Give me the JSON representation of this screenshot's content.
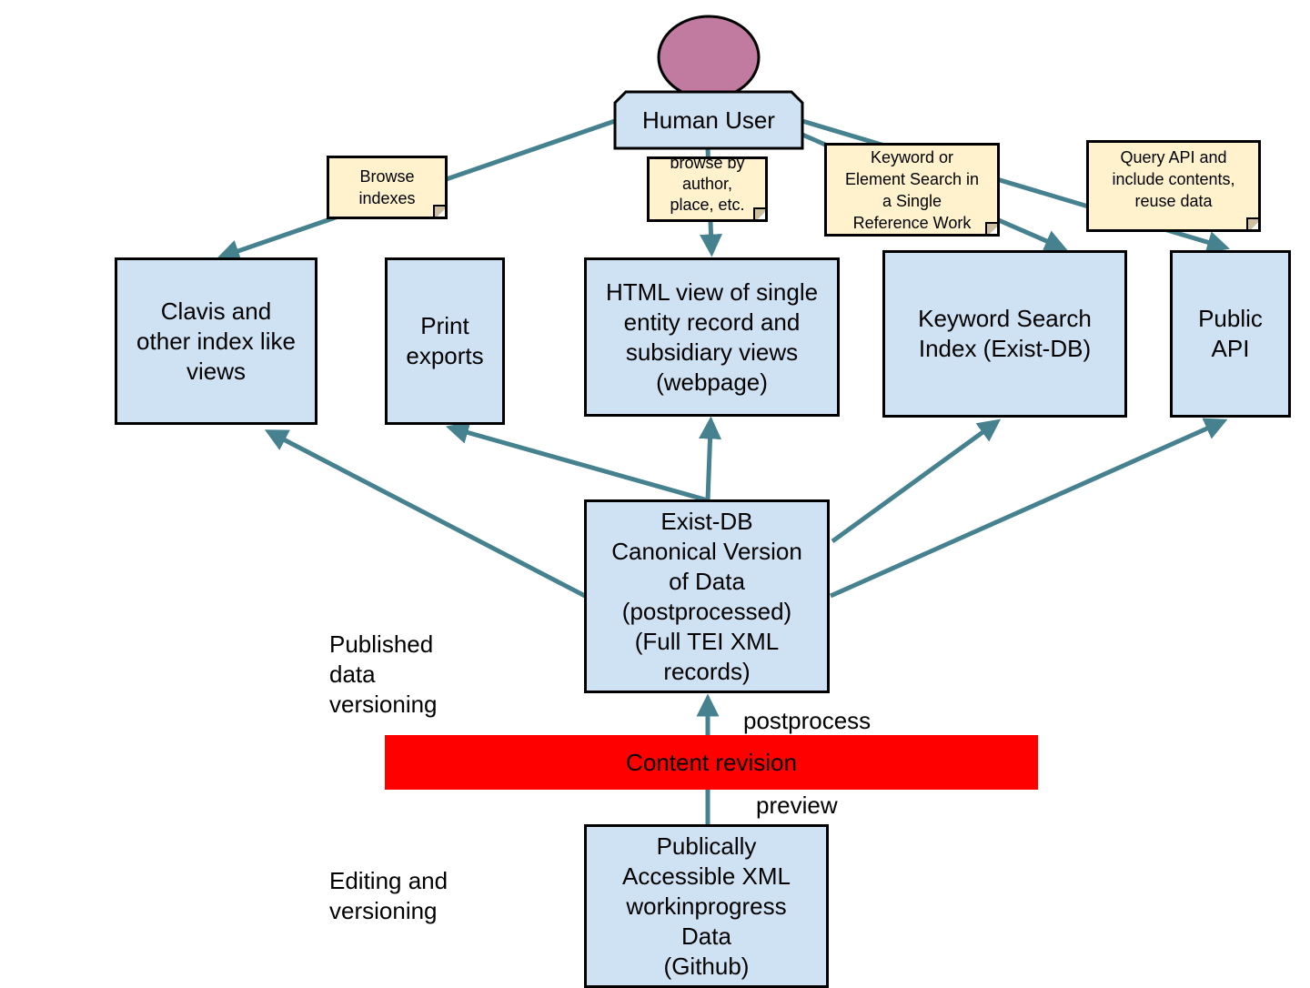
{
  "colors": {
    "box_fill": "#cfe2f3",
    "note_fill": "#fff2cc",
    "connector": "#45818e",
    "user_head": "#c27ba0",
    "revision_bar": "#ff0000"
  },
  "user": {
    "label": "Human User"
  },
  "notes": {
    "browse_indexes": "Browse\nindexes",
    "browse_by": "browse by\nauthor,\nplace, etc.",
    "keyword": "Keyword or\nElement Search in\na Single\nReference Work",
    "query_api": "Query API and\ninclude contents,\nreuse data"
  },
  "outputs": {
    "clavis": "Clavis and\nother index like\nviews",
    "print": "Print\nexports",
    "html": "HTML view of single\nentity record and\nsubsidiary views\n(webpage)",
    "keyword_index": "Keyword Search\nIndex (Exist-DB)",
    "api": "Public\nAPI"
  },
  "existdb": "Exist-DB\nCanonical Version\nof Data\n(postprocessed)\n(Full TEI XML\nrecords)",
  "github": "Publically\nAccessible XML\nworkinprogress\nData\n(Github)",
  "revision": "Content revision",
  "edge_labels": {
    "postprocess": "postprocess",
    "preview": "preview"
  },
  "side_labels": {
    "published": "Published\ndata\nversioning",
    "editing": "Editing and\nversioning"
  }
}
